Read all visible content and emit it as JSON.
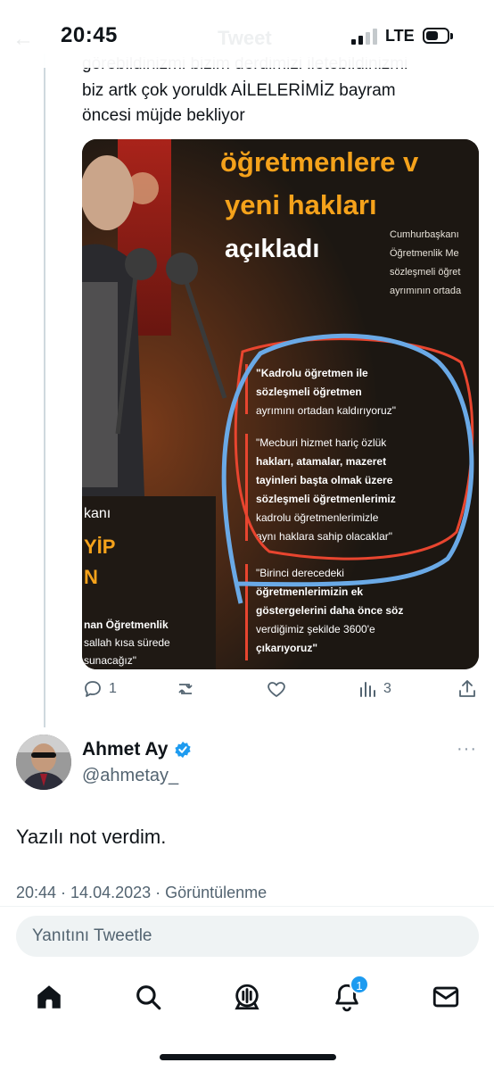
{
  "status_bar": {
    "time": "20:45",
    "network": "LTE",
    "ghost_title": "Tweet",
    "battery_level": 0.6
  },
  "parent_tweet": {
    "text_line_cut": "görebildinizmi bizim derdimizi iletebildinizmi",
    "text_line_2": "biz artk çok yoruldk AİLELERİMİZ bayram",
    "text_line_3": "öncesi müjde bekliyor",
    "media": {
      "headline_1": "öğretmenlere v",
      "headline_2": "yeni hakları",
      "headline_3": "açıkladı",
      "side_text": [
        "Cumhurbaşkanı",
        "Öğretmenlik Me",
        "sözleşmeli öğret",
        "ayrımının ortada"
      ],
      "quote_1": [
        "\"Kadrolu öğretmen ile",
        "sözleşmeli öğretmen",
        "ayrımını ortadan kaldırıyoruz\""
      ],
      "quote_2": [
        "\"Mecburi hizmet hariç özlük",
        "hakları, atamalar, mazeret",
        "tayinleri başta olmak üzere",
        "sözleşmeli öğretmenlerimiz",
        "kadrolu öğretmenlerimizle",
        "aynı haklara sahip olacaklar\""
      ],
      "quote_3": [
        "\"Birinci derecedeki",
        "öğretmenlerimizin ek",
        "göstergelerini daha önce söz",
        "verdiğimiz şekilde 3600'e",
        "çıkarıyoruz\""
      ],
      "left_text": [
        "kanı",
        "YİP",
        "N",
        "nan Öğretmenlik",
        "sallah kısa sürede",
        "sunacağız\""
      ]
    },
    "actions": {
      "reply_icon": "reply-icon",
      "reply_count": "1",
      "retweet_icon": "retweet-icon",
      "retweet_count": "",
      "like_icon": "heart-icon",
      "like_count": "",
      "views_icon": "bar-chart-icon",
      "views_count": "3",
      "share_icon": "share-icon"
    }
  },
  "reply_tweet": {
    "name": "Ahmet Ay",
    "handle": "@ahmetay_",
    "text": "Yazılı not verdim.",
    "meta": "20:44 · 14.04.2023 · Görüntülenme",
    "more": "···"
  },
  "reply_box": {
    "placeholder": "Yanıtını Tweetle"
  },
  "bottom_nav": {
    "items": [
      "home-icon",
      "search-icon",
      "spaces-icon",
      "notifications-icon",
      "messages-icon"
    ],
    "notification_badge": "1"
  },
  "colors": {
    "accent": "#1d9bf0",
    "muted": "#536471",
    "media_orange": "#f5a21b",
    "annot_red": "#e8452f",
    "annot_blue": "#6aa9e6"
  }
}
